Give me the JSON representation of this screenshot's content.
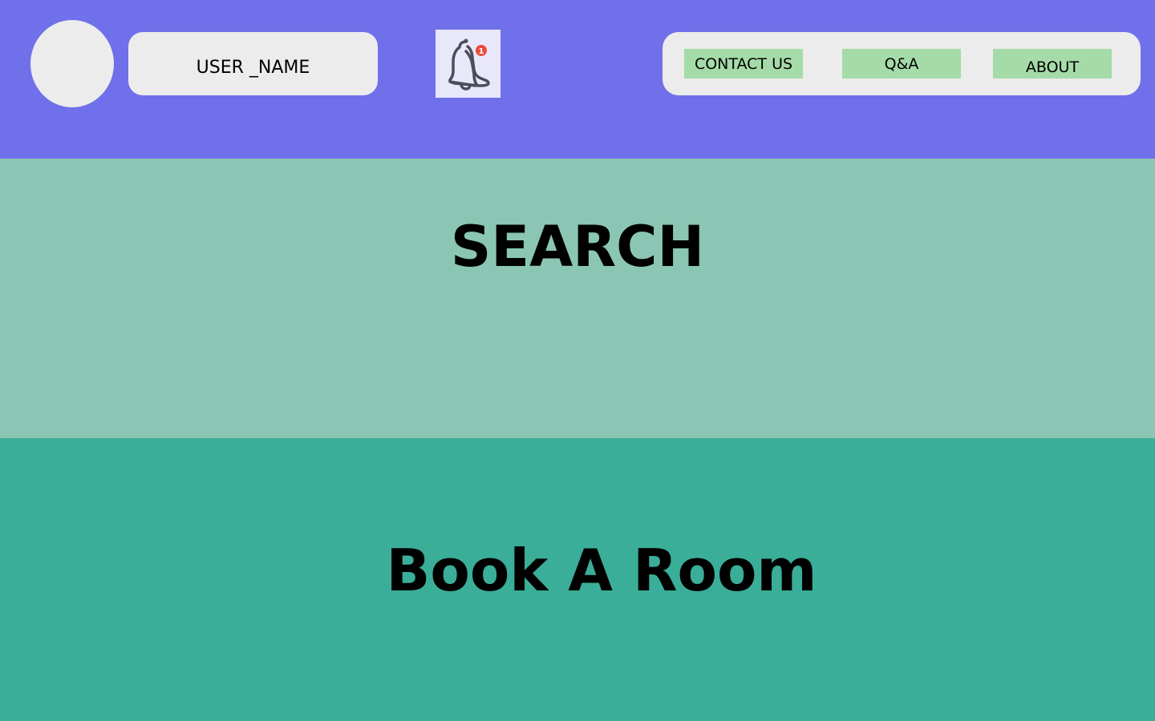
{
  "header": {
    "username": "USER _NAME",
    "notification_count": "1",
    "nav": {
      "contact_label": "CONTACT US",
      "qa_label": "Q&A",
      "about_label": "ABOUT"
    }
  },
  "main": {
    "search_label": "SEARCH",
    "book_label": "Book A Room"
  },
  "colors": {
    "header_bg": "#7070ea",
    "search_bg": "#8ac6b3",
    "book_bg": "#3aae98",
    "nav_button_bg": "#a5dba8",
    "badge": "#e94b3c"
  },
  "icons": {
    "notification": "bell-icon"
  }
}
